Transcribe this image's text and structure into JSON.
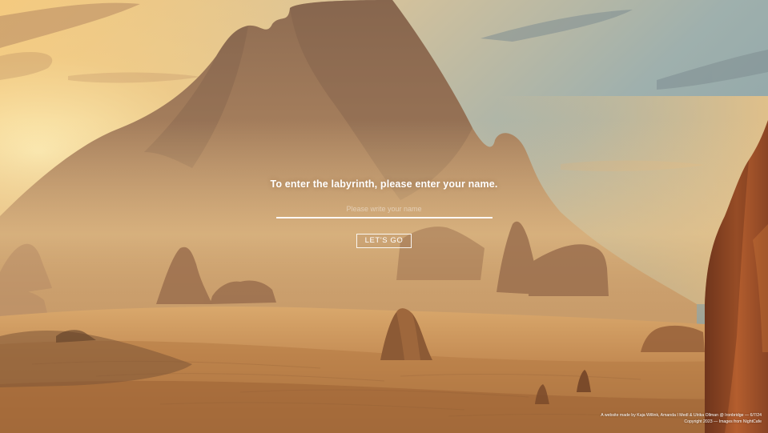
{
  "login": {
    "prompt": "To enter the labyrinth, please enter your name.",
    "name_placeholder": "Please write your name",
    "name_value": "",
    "submit_label": "LET'S GO"
  },
  "footer": {
    "credit_line": "A website made by Kaja Willink, Amanda I Medl & Ulrika Ollman @ Ironbridge — 6/7/24",
    "copyright_line": "Copyright 2023 — Images from NightCafe"
  },
  "colors": {
    "text": "#ffffff",
    "sky_top": "#8ea7ad",
    "sun_glow": "#f7d58a",
    "sand": "#b9773e",
    "rock": "#9a5a34"
  },
  "background": {
    "icon": "desert-mountain-landscape"
  }
}
